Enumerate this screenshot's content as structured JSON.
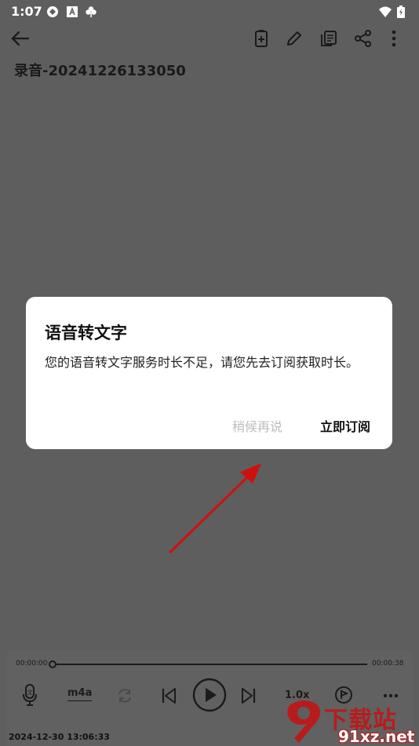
{
  "status_bar": {
    "time": "1:07"
  },
  "note": {
    "title": "录音-20241226133050"
  },
  "dialog": {
    "title": "语音转文字",
    "message": "您的语音转文字服务时长不足，请您先去订阅获取时长。",
    "later_button": "稍候再说",
    "subscribe_button": "立即订阅"
  },
  "player": {
    "current_time": "00:00:00",
    "total_time": "00:00:38",
    "progress": 0,
    "format": "m4a",
    "speed": "1.0x"
  },
  "timestamp": "2024-12-30 13:06:33",
  "watermark": {
    "site_cn": "下载站",
    "site_url": "91xz.net"
  }
}
